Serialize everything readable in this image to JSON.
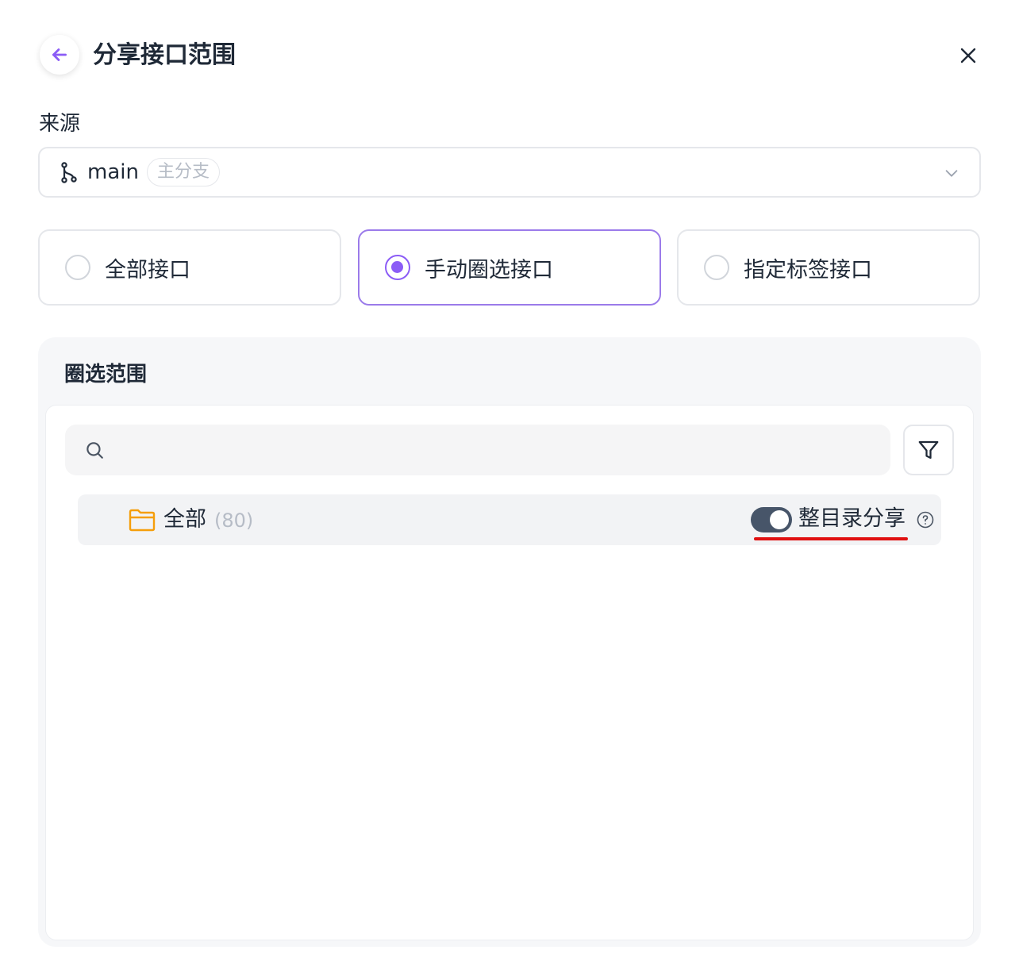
{
  "header": {
    "title": "分享接口范围",
    "back_icon": "arrow-left-icon",
    "close_icon": "close-icon",
    "accent_color": "#8b5cf6"
  },
  "source": {
    "label": "来源",
    "branch_icon": "git-branch-icon",
    "branch_name": "main",
    "branch_tag": "主分支",
    "chevron_icon": "chevron-down-icon"
  },
  "modes": [
    {
      "label": "全部接口",
      "selected": false
    },
    {
      "label": "手动圈选接口",
      "selected": true
    },
    {
      "label": "指定标签接口",
      "selected": false
    }
  ],
  "scope": {
    "title": "圈选范围",
    "search_icon": "search-icon",
    "search_placeholder": "",
    "filter_icon": "filter-icon",
    "tree": {
      "folder_icon": "folder-icon",
      "folder_color": "#f59e0b",
      "name": "全部",
      "count": "(80)",
      "share_toggle_on": true,
      "share_label": "整目录分享",
      "help_icon": "help-circle-icon"
    }
  },
  "annotation_color": "#e01010"
}
